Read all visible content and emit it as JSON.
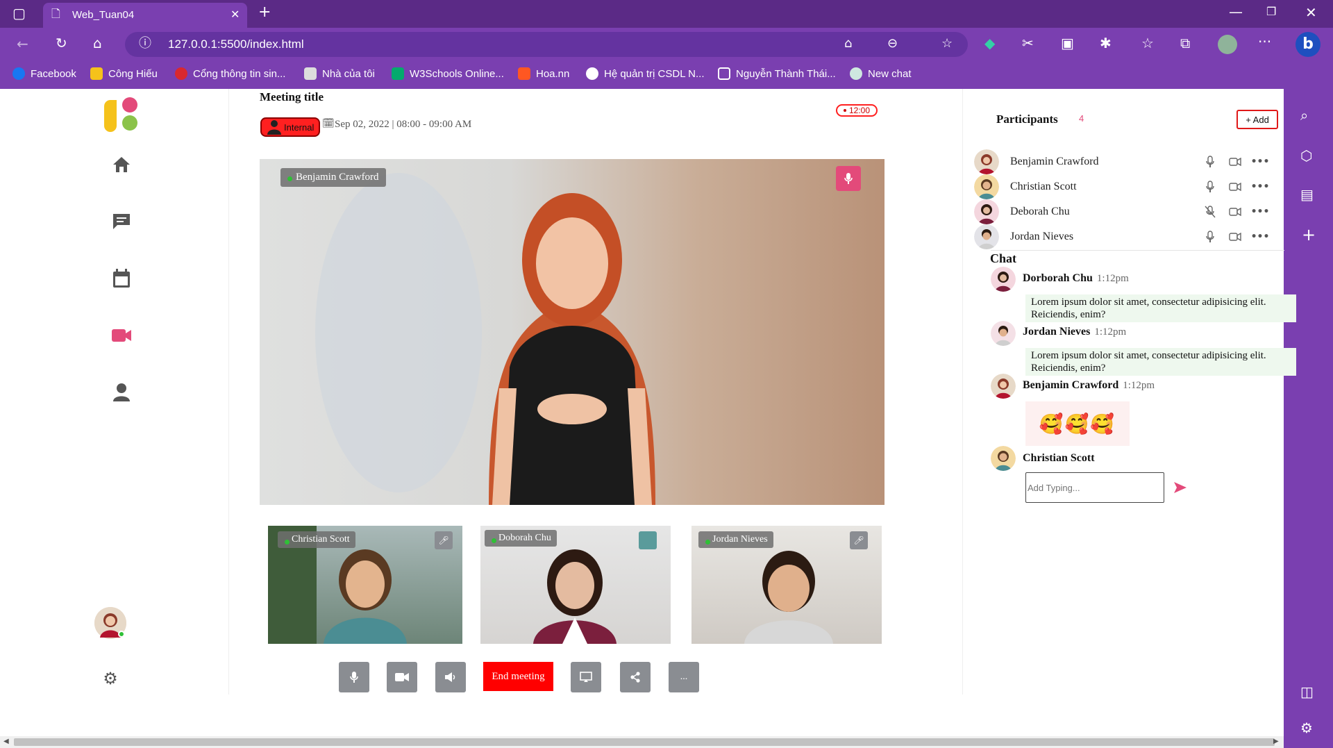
{
  "browser": {
    "tab_title": "Web_Tuan04",
    "url": "127.0.0.1:5500/index.html",
    "bookmarks": [
      "Facebook",
      "Công Hiếu",
      "Cổng thông tin sin...",
      "Nhà của tôi",
      "W3Schools Online...",
      "Hoa.nn",
      "Hệ quản trị CSDL N...",
      "Nguyễn Thành Thái...",
      "New chat"
    ]
  },
  "meeting": {
    "title": "Meeting title",
    "tag": "Internal",
    "date": "Sep 02, 2022 | 08:00 - 09:00 AM",
    "timer": "12:00",
    "main_speaker": "Benjamin Crawford",
    "tiles": [
      "Christian Scott",
      "Doborah Chu",
      "Jordan Nieves"
    ],
    "end_label": "End meeting",
    "more_label": "..."
  },
  "participants": {
    "title": "Participants",
    "count": "4",
    "add_label": "+ Add",
    "list": [
      "Benjamin Crawford",
      "Christian Scott",
      "Deborah Chu",
      "Jordan Nieves"
    ]
  },
  "chat": {
    "title": "Chat",
    "messages": [
      {
        "name": "Dorborah Chu",
        "time": "1:12pm",
        "text": "Lorem ipsum dolor sit amet, consectetur adipisicing elit. Reiciendis, enim?"
      },
      {
        "name": "Jordan Nieves",
        "time": "1:12pm",
        "text": "Lorem ipsum dolor sit amet, consectetur adipisicing elit. Reiciendis, enim?"
      },
      {
        "name": "Benjamin Crawford",
        "time": "1:12pm",
        "text": "🥰🥰🥰"
      }
    ],
    "composer_name": "Christian Scott",
    "placeholder": "Add Typing..."
  },
  "colors": {
    "accent": "#e34a7a",
    "browser": "#7a3fb0",
    "end": "#ff0000"
  }
}
